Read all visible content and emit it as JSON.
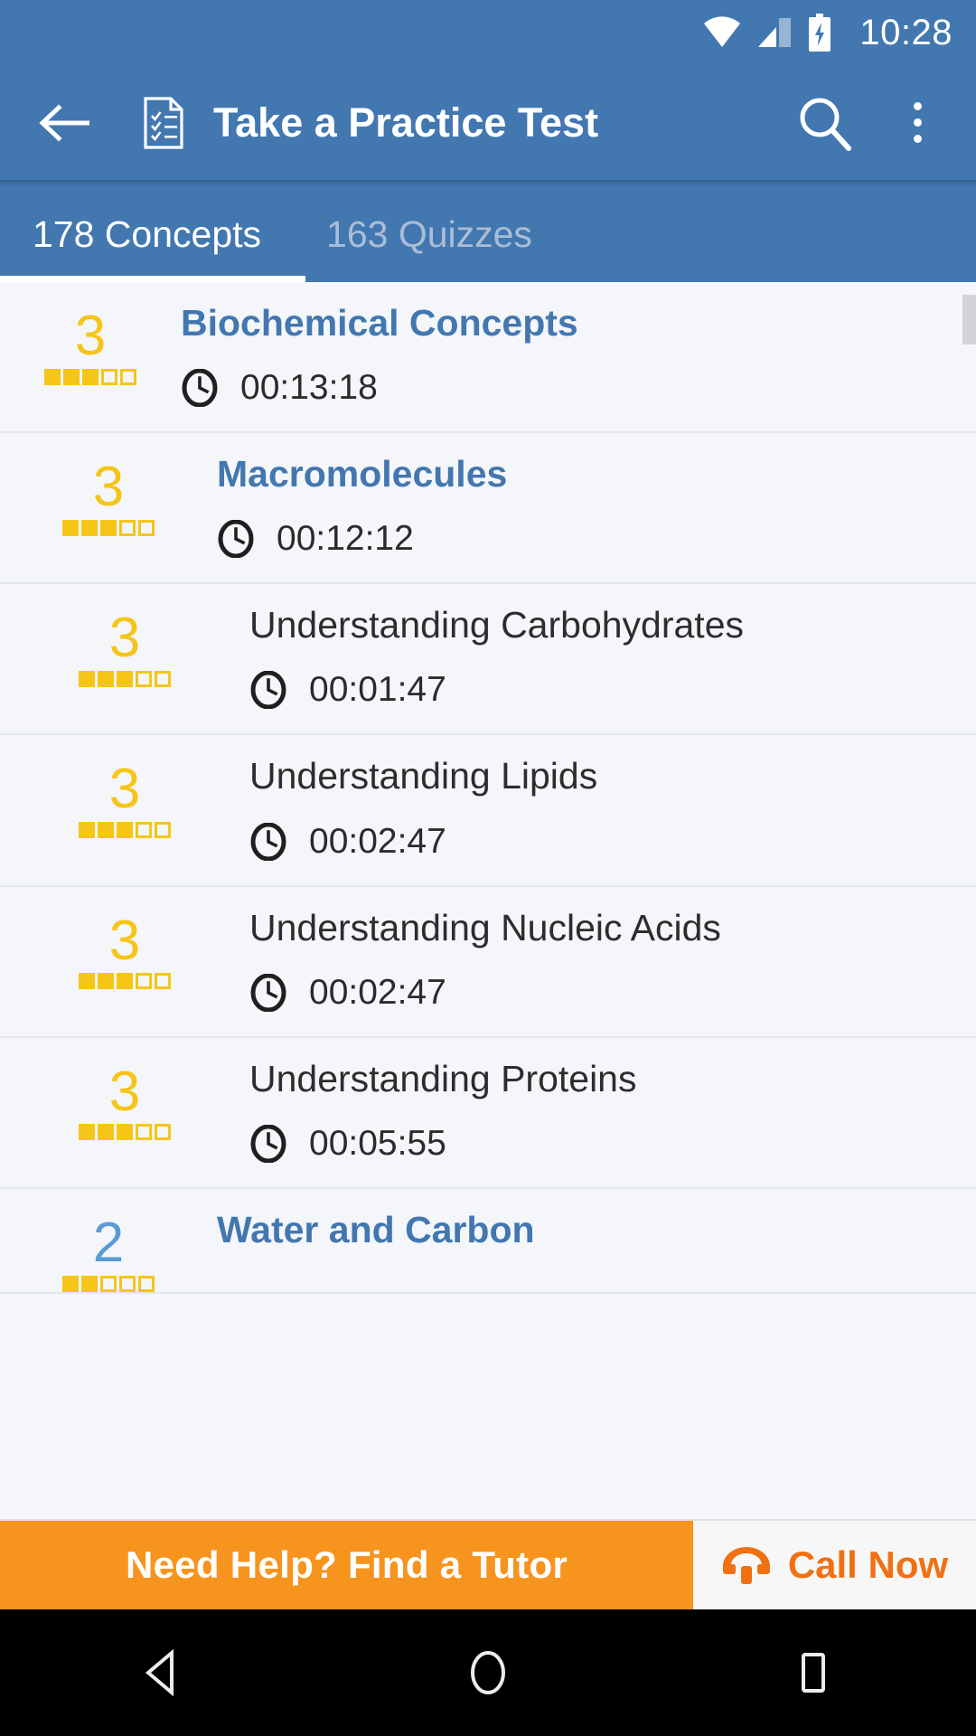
{
  "status_bar": {
    "time": "10:28",
    "icons": [
      "wifi-icon",
      "signal-icon",
      "battery-charging-icon"
    ]
  },
  "app_bar": {
    "back_icon": "arrow-left-icon",
    "doc_icon": "checklist-document-icon",
    "title": "Take a Practice Test",
    "search_icon": "search-icon",
    "overflow_icon": "more-vertical-icon"
  },
  "tabs": [
    {
      "label": "178 Concepts",
      "active": true
    },
    {
      "label": "163 Quizzes",
      "active": false
    }
  ],
  "colors": {
    "primary_blue": "#4277b0",
    "link_blue": "#4277b0",
    "rating_yellow": "#f5c518",
    "rating_blue": "#5b9bd5",
    "banner_orange": "#f7941e",
    "call_orange": "#f07012",
    "list_bg": "#f4f6fa"
  },
  "list": {
    "rating_max": 5,
    "clock_icon": "clock-icon",
    "rows": [
      {
        "title": "Biochemical Concepts",
        "time": "00:13:18",
        "rating": "3",
        "rating_filled": 3,
        "level": 0,
        "style": "link",
        "rating_color": "yellow"
      },
      {
        "title": "Macromolecules",
        "time": "00:12:12",
        "rating": "3",
        "rating_filled": 3,
        "level": 1,
        "style": "link",
        "rating_color": "yellow"
      },
      {
        "title": "Understanding Carbohydrates",
        "time": "00:01:47",
        "rating": "3",
        "rating_filled": 3,
        "level": 2,
        "style": "plain",
        "rating_color": "yellow"
      },
      {
        "title": "Understanding Lipids",
        "time": "00:02:47",
        "rating": "3",
        "rating_filled": 3,
        "level": 2,
        "style": "plain",
        "rating_color": "yellow"
      },
      {
        "title": "Understanding Nucleic Acids",
        "time": "00:02:47",
        "rating": "3",
        "rating_filled": 3,
        "level": 2,
        "style": "plain",
        "rating_color": "yellow"
      },
      {
        "title": "Understanding Proteins",
        "time": "00:05:55",
        "rating": "3",
        "rating_filled": 3,
        "level": 2,
        "style": "plain",
        "rating_color": "yellow"
      },
      {
        "title": "Water and Carbon",
        "time": "",
        "rating": "2",
        "rating_filled": 2,
        "level": 1,
        "style": "link",
        "rating_color": "blue"
      }
    ]
  },
  "banner": {
    "main_text": "Need Help? Find a Tutor",
    "phone_icon": "phone-icon",
    "call_text": "Call Now"
  },
  "nav_bar": {
    "back": "nav-back-icon",
    "home": "nav-home-icon",
    "recents": "nav-recents-icon"
  }
}
